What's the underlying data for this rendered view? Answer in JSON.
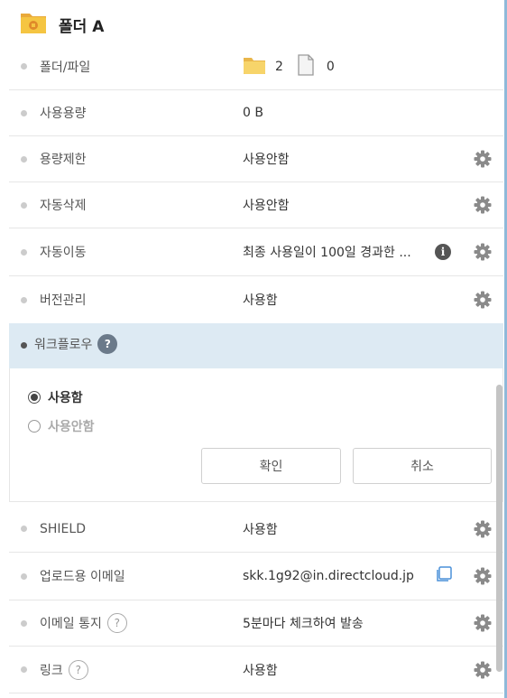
{
  "header": {
    "title": "폴더 A",
    "icon": "folder-icon"
  },
  "rows": {
    "files": {
      "label": "폴더/파일",
      "folder_count": "2",
      "file_count": "0"
    },
    "usage": {
      "label": "사용용량",
      "value": "0 B"
    },
    "quota": {
      "label": "용량제한",
      "value": "사용안함"
    },
    "auto_delete": {
      "label": "자동삭제",
      "value": "사용안함"
    },
    "auto_move": {
      "label": "자동이동",
      "value": "최종 사용일이 100일 경과한 ..."
    },
    "versioning": {
      "label": "버전관리",
      "value": "사용함"
    },
    "shield": {
      "label": "SHIELD",
      "value": "사용함"
    },
    "upload_email": {
      "label": "업로드용 이메일",
      "value": "skk.1g92@in.directcloud.jp"
    },
    "email_notify": {
      "label": "이메일 통지",
      "value": "5분마다 체크하여 발송"
    },
    "link": {
      "label": "링크",
      "value": "사용함"
    }
  },
  "workflow": {
    "label": "워크플로우",
    "help": "?",
    "option_on": "사용함",
    "option_off": "사용안함",
    "selected": "on",
    "confirm": "확인",
    "cancel": "취소"
  },
  "help_mark": "?",
  "colors": {
    "accent": "#8fb9d9",
    "workflow_bg": "#ddeaf3",
    "folder": "#f5c542"
  }
}
